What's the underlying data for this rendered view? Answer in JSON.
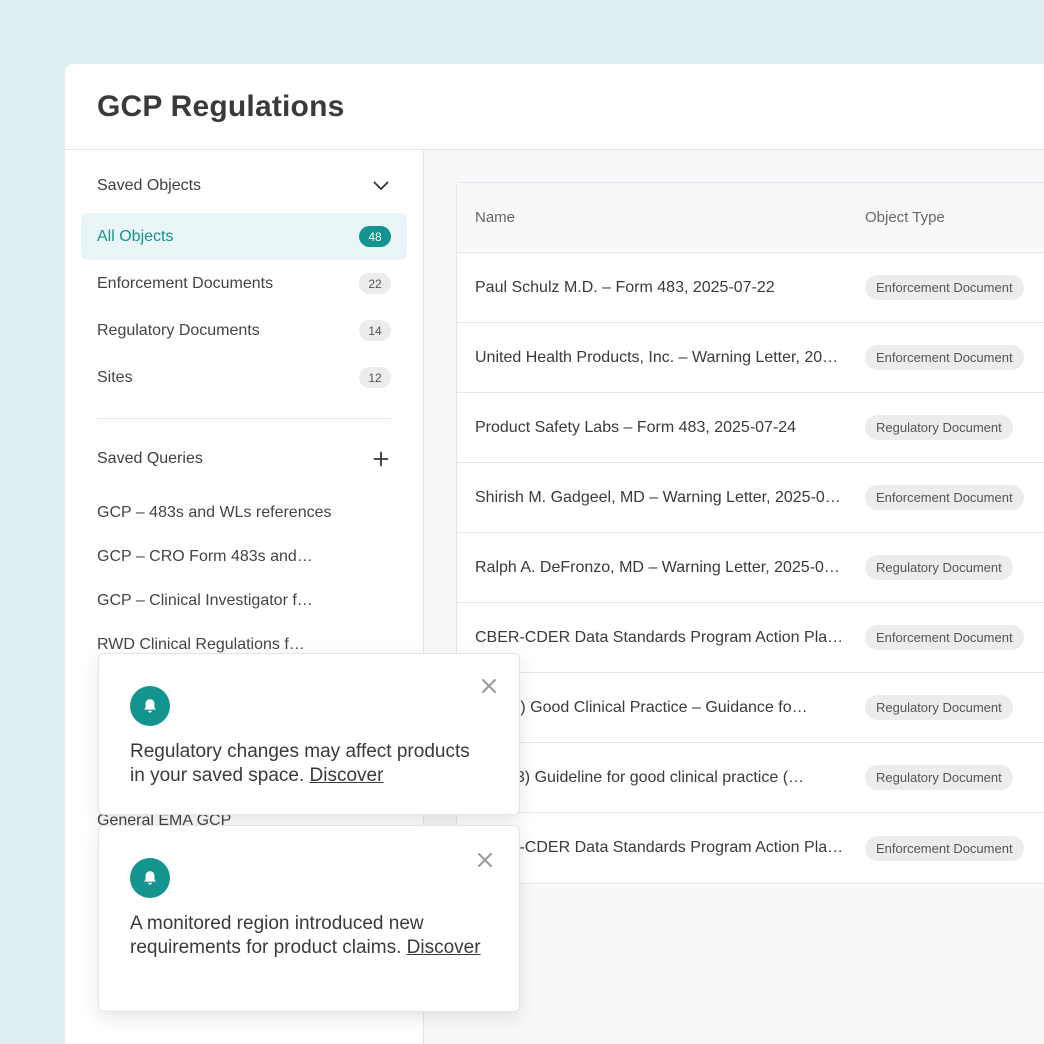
{
  "app": {
    "title": "GCP Regulations"
  },
  "sidebar": {
    "saved_objects": {
      "label": "Saved Objects",
      "items": [
        {
          "label": "All Objects",
          "count": "48"
        },
        {
          "label": "Enforcement Documents",
          "count": "22"
        },
        {
          "label": "Regulatory Documents",
          "count": "14"
        },
        {
          "label": "Sites",
          "count": "12"
        }
      ]
    },
    "saved_queries": {
      "label": "Saved Queries",
      "items": [
        "GCP – 483s and WLs references",
        "GCP – CRO Form 483s and…",
        "GCP – Clinical Investigator f…",
        "RWD Clinical Regulations f…",
        "",
        "",
        "",
        "General EMA GCP"
      ]
    }
  },
  "table": {
    "columns": [
      "Name",
      "Object Type"
    ],
    "rows": [
      {
        "name": "Paul Schulz M.D. – Form 483, 2025-07-22",
        "type": "Enforcement Document"
      },
      {
        "name": "United Health Products, Inc. – Warning Letter, 20…",
        "type": "Enforcement Document"
      },
      {
        "name": "Product Safety Labs – Form 483, 2025-07-24",
        "type": "Regulatory Document"
      },
      {
        "name": "Shirish M. Gadgeel, MD – Warning Letter, 2025-0…",
        "type": "Enforcement Document"
      },
      {
        "name": "Ralph A. DeFronzo, MD – Warning Letter, 2025-0…",
        "type": "Regulatory Document"
      },
      {
        "name": "CBER-CDER Data Standards Program Action Pla…",
        "type": "Enforcement Document"
      },
      {
        "name": "E6(R3) Good Clinical Practice – Guidance fo…",
        "type": "Regulatory Document"
      },
      {
        "name": "E6 (R3) Guideline for good clinical practice (…",
        "type": "Regulatory Document"
      },
      {
        "name": "CBER-CDER Data Standards Program Action Pla…",
        "type": "Enforcement Document"
      }
    ]
  },
  "toasts": [
    {
      "message": "Regulatory changes may affect products in your saved space. ",
      "link": "Discover"
    },
    {
      "message": "A monitored region introduced new requirements for product claims. ",
      "link": "Discover"
    }
  ],
  "colors": {
    "accent": "#14948e",
    "background": "#dfeef3"
  },
  "icons": [
    "chevron-down-icon",
    "plus-icon",
    "bell-icon",
    "close-icon"
  ]
}
